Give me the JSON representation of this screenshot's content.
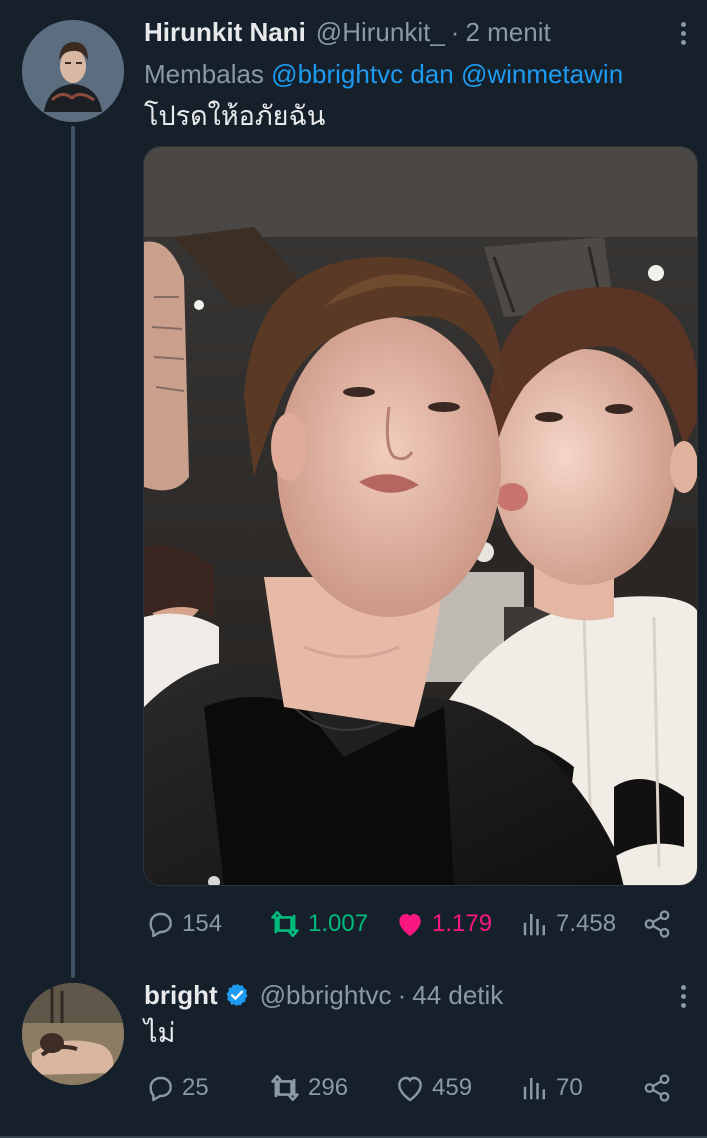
{
  "tweet1": {
    "name": "Hirunkit Nani",
    "handle": "@Hirunkit_",
    "separator": "·",
    "time": "2 menit",
    "reply_prefix": "Membalas",
    "reply_mention1": "@bbrightvc",
    "reply_conj": "dan",
    "reply_mention2": "@winmetawin",
    "text": "โปรดให้อภัยฉัน",
    "actions": {
      "replies": "154",
      "retweets": "1.007",
      "likes": "1.179",
      "views": "7.458"
    },
    "liked": true
  },
  "tweet2": {
    "name": "bright",
    "handle": "@bbrightvc",
    "separator": "·",
    "time": "44 detik",
    "text": "ไม่",
    "verified": true,
    "actions": {
      "replies": "25",
      "retweets": "296",
      "likes": "459",
      "views": "70"
    }
  },
  "colors": {
    "background": "#15202b",
    "link": "#1d9bf0",
    "retweet_active": "#00ba7c",
    "like_active": "#f91880",
    "muted": "#8b98a5"
  },
  "icons": [
    "reply-icon",
    "retweet-icon",
    "like-icon",
    "views-icon",
    "share-icon",
    "more-icon",
    "verified-badge-icon"
  ]
}
